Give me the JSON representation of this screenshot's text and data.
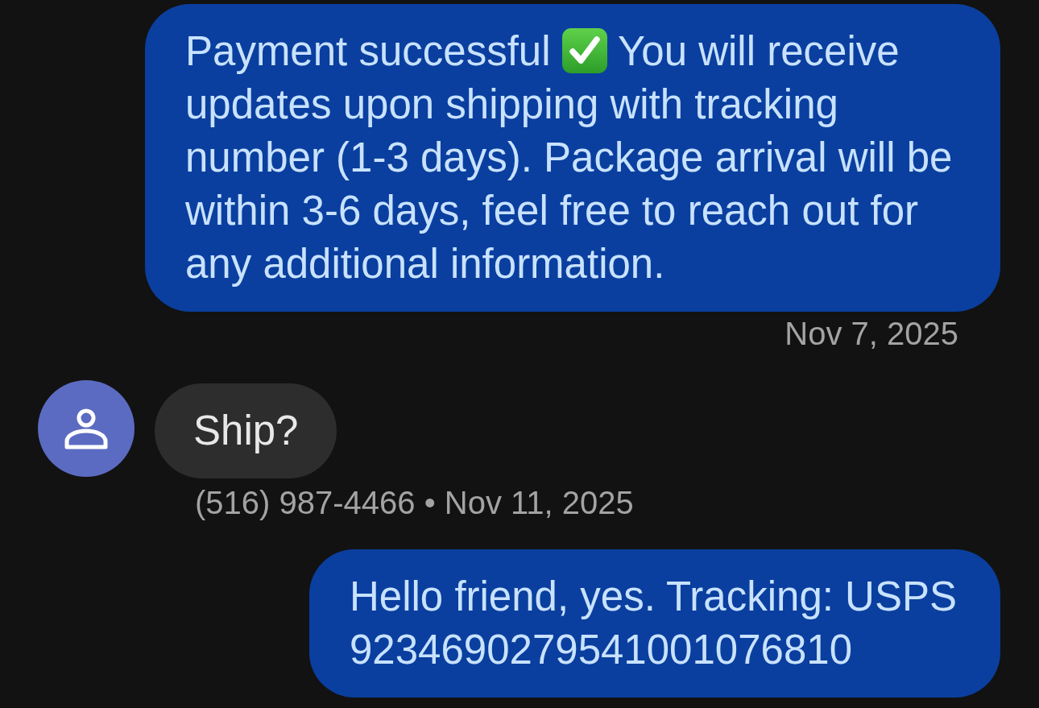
{
  "messages": [
    {
      "kind": "outgoing",
      "parts": [
        {
          "kind": "text",
          "text": "Payment successful"
        },
        {
          "kind": "check-emoji"
        },
        {
          "kind": "text",
          "text": "You will receive updates upon shipping with tracking number (1-3 days). Package arrival will be within 3-6 days, feel free to reach out for any additional information."
        }
      ],
      "footer": "Nov 7, 2025"
    },
    {
      "kind": "incoming",
      "parts": [
        {
          "kind": "text",
          "text": "Ship?"
        }
      ],
      "footer": "(516) 987-4466 • Nov 11, 2025"
    },
    {
      "kind": "outgoing",
      "parts": [
        {
          "kind": "text",
          "text": "Hello friend, yes. Tracking: USPS 9234690279541001076810"
        }
      ]
    }
  ]
}
